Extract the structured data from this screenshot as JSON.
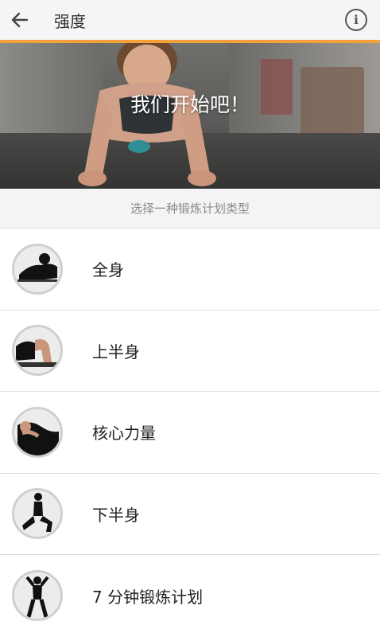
{
  "header": {
    "back_icon": "arrow-left-icon",
    "title": "强度",
    "info_icon": "info-icon",
    "info_glyph": "i",
    "accent_color": "#f4a13c"
  },
  "hero": {
    "headline": "我们开始吧！"
  },
  "subtitle": "选择一种锻炼计划类型",
  "workout_types": [
    {
      "label": "全身",
      "icon": "full-body-workout-icon"
    },
    {
      "label": "上半身",
      "icon": "upper-body-workout-icon"
    },
    {
      "label": "核心力量",
      "icon": "core-strength-workout-icon"
    },
    {
      "label": "下半身",
      "icon": "lower-body-workout-icon"
    },
    {
      "label": "7 分钟锻炼计划",
      "icon": "seven-minute-workout-icon"
    }
  ]
}
